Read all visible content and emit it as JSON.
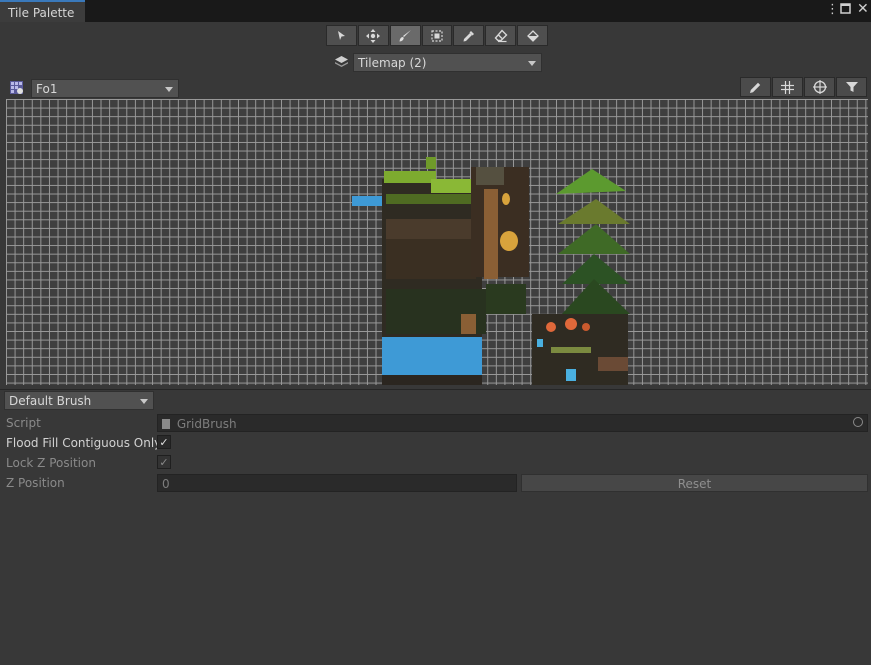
{
  "window": {
    "tab_title": "Tile Palette"
  },
  "tools": [
    {
      "name": "select-tool-button",
      "icon": "arrow-icon",
      "active": false
    },
    {
      "name": "move-tool-button",
      "icon": "move-arrows-icon",
      "active": false
    },
    {
      "name": "paint-tool-button",
      "icon": "brush-icon",
      "active": true
    },
    {
      "name": "box-fill-tool-button",
      "icon": "box-fill-icon",
      "active": false
    },
    {
      "name": "picker-tool-button",
      "icon": "eyedropper-icon",
      "active": false
    },
    {
      "name": "erase-tool-button",
      "icon": "eraser-icon",
      "active": false
    },
    {
      "name": "fill-tool-button",
      "icon": "paint-bucket-icon",
      "active": false
    }
  ],
  "active_tilemap": {
    "value": "Tilemap (2)"
  },
  "palette": {
    "value": "Fo1"
  },
  "brush": {
    "selected": "Default Brush",
    "script_label": "Script",
    "script_value": "GridBrush",
    "flood_fill_label": "Flood Fill Contiguous Only",
    "flood_fill_checked": true,
    "lock_z_label": "Lock Z Position",
    "lock_z_checked": true,
    "z_position_label": "Z Position",
    "z_position_value": "0",
    "reset_label": "Reset"
  },
  "colors": {
    "accent": "#3a79bb",
    "panel": "#383838",
    "grid_line": "#9a9a9a"
  }
}
